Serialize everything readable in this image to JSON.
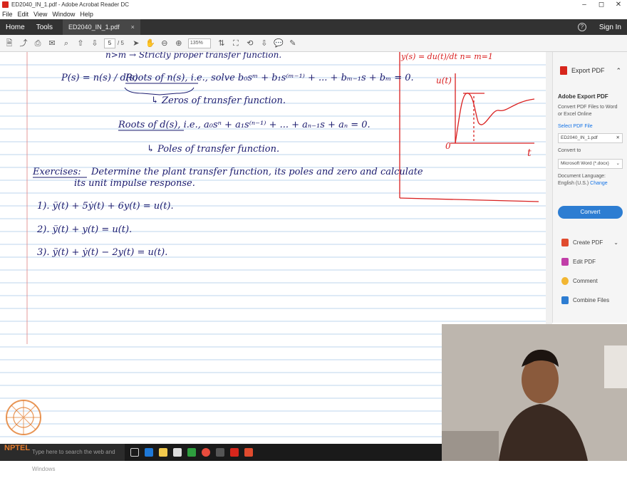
{
  "window": {
    "title": "ED2040_IN_1.pdf - Adobe Acrobat Reader DC",
    "controls": [
      "–",
      "◻",
      "✕"
    ]
  },
  "menu": [
    "File",
    "Edit",
    "View",
    "Window",
    "Help"
  ],
  "tabs": {
    "home": "Home",
    "tools": "Tools",
    "document": "ED2040_IN_1.pdf",
    "close": "×",
    "sign_in": "Sign In",
    "help": "?"
  },
  "toolbar": {
    "page_current": "5",
    "page_total": "/ 5",
    "zoom": "135%"
  },
  "notes": {
    "top_line": "n>m → Strictly proper transfer function.",
    "p_def": "P(s) = n(s) / d(s)",
    "roots_n": "Roots of n(s), i.e., solve  b₀sᵐ + b₁s⁽ᵐ⁻¹⁾ + ... + bₘ₋₁s + bₘ = 0.",
    "zeros": "↳ Zeros of transfer function.",
    "roots_d": "Roots of d(s), i.e.,  a₀sⁿ + a₁s⁽ⁿ⁻¹⁾ + ... + aₙ₋₁s + aₙ = 0.",
    "poles": "↳ Poles of transfer function.",
    "exercise_label": "Exercises:",
    "exercise_text": "Determine the plant transfer function, its poles and zero and calculate",
    "exercise_text2": "its unit impulse response.",
    "eq1": "1).   ÿ(t) + 5ẏ(t) + 6y(t) = u(t).",
    "eq2": "2).   ÿ(t) + y(t) = u(t).",
    "eq3": "3).   ÿ(t) + ẏ(t) − 2y(t) = u(t).",
    "graph_top": "y(s) = du(t)/dt   n=   m=1",
    "graph_ylabel": "u(t)",
    "graph_origin": "0",
    "graph_xlabel": "t"
  },
  "right_panel": {
    "export_pdf": "Export PDF",
    "adobe_export_title": "Adobe Export PDF",
    "adobe_export_desc": "Convert PDF Files to Word or Excel Online",
    "select_pdf": "Select PDF File",
    "selected_file": "ED2040_IN_1.pdf",
    "convert_to": "Convert to",
    "convert_option": "Microsoft Word (*.docx)",
    "doc_language": "Document Language:",
    "language_value": "English (U.S.)",
    "change": "Change",
    "convert_button": "Convert",
    "create_pdf": "Create PDF",
    "edit_pdf": "Edit PDF",
    "comment": "Comment",
    "combine_files": "Combine Files"
  },
  "taskbar": {
    "search": "Type here to search the web and Windows"
  },
  "nptel": "NPTEL",
  "colors": {
    "ink": "#1a1a6e",
    "red_ink": "#d92020",
    "accent": "#2d7dd2",
    "ruled": "#a7c7e7"
  }
}
